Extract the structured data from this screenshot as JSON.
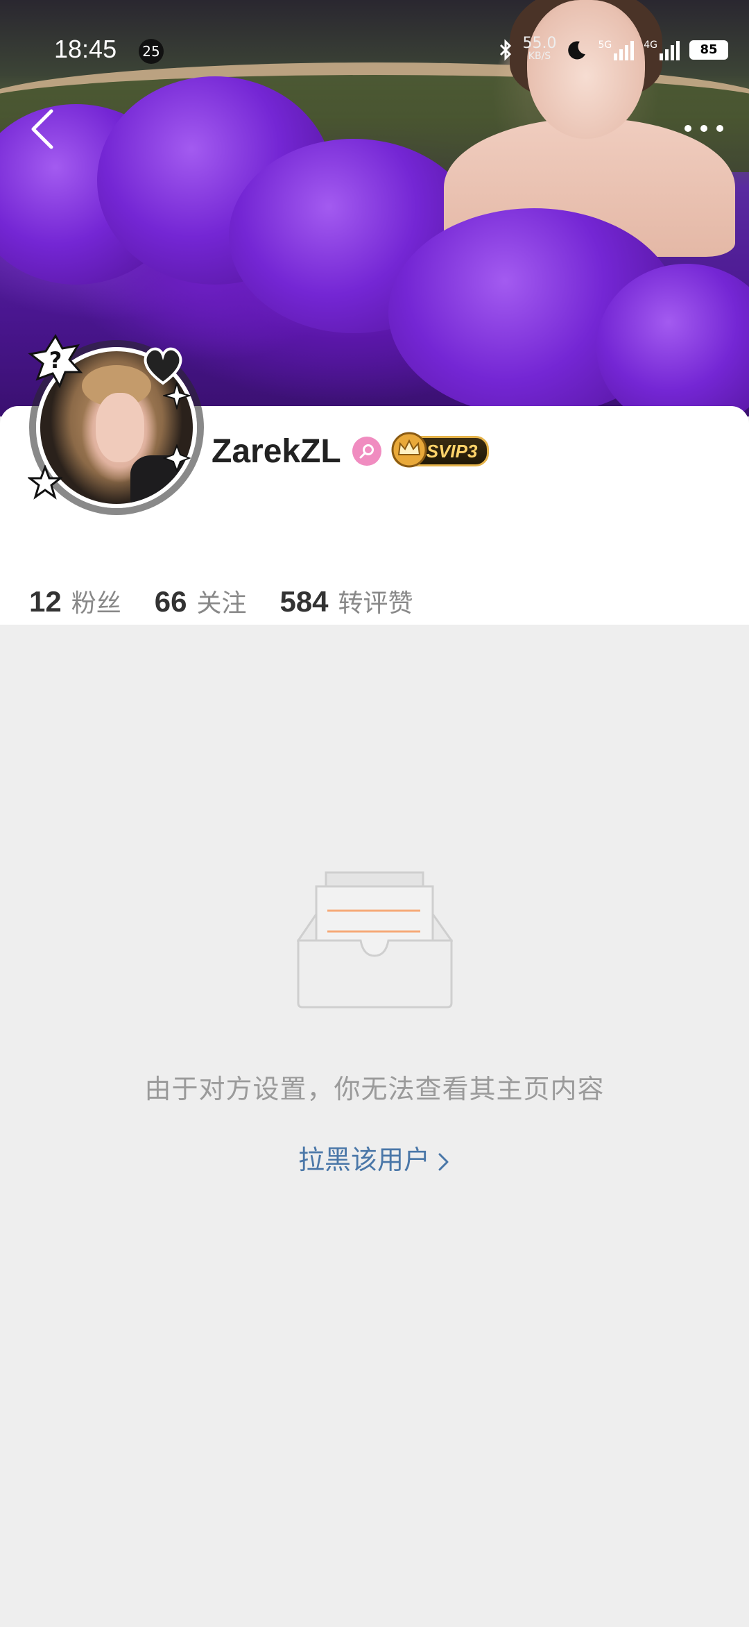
{
  "status_bar": {
    "time": "18:45",
    "notification_count": "25",
    "net_speed_value": "55.0",
    "net_speed_unit": "KB/S",
    "sim1_label": "5G",
    "sim2_label": "4G",
    "battery": "85"
  },
  "profile": {
    "username": "ZarekZL",
    "gender": "female",
    "vip_label": "SVIP3",
    "stats": [
      {
        "value": "12",
        "label": "粉丝"
      },
      {
        "value": "66",
        "label": "关注"
      },
      {
        "value": "584",
        "label": "转评赞"
      }
    ]
  },
  "empty_state": {
    "message": "由于对方设置，你无法查看其主页内容",
    "block_link_label": "拉黑该用户"
  },
  "colors": {
    "accent_link": "#4a77a8",
    "vip_gold": "#ffd36a",
    "gender_pink": "#f08cc0",
    "page_background": "#eeeeee",
    "doc_lines": "#f6a978"
  },
  "icons": {
    "back": "chevron-left-icon",
    "more": "more-dots-icon",
    "gender": "female-icon",
    "vip": "crown-icon",
    "empty": "empty-inbox-icon",
    "link_arrow": "chevron-right-icon"
  }
}
